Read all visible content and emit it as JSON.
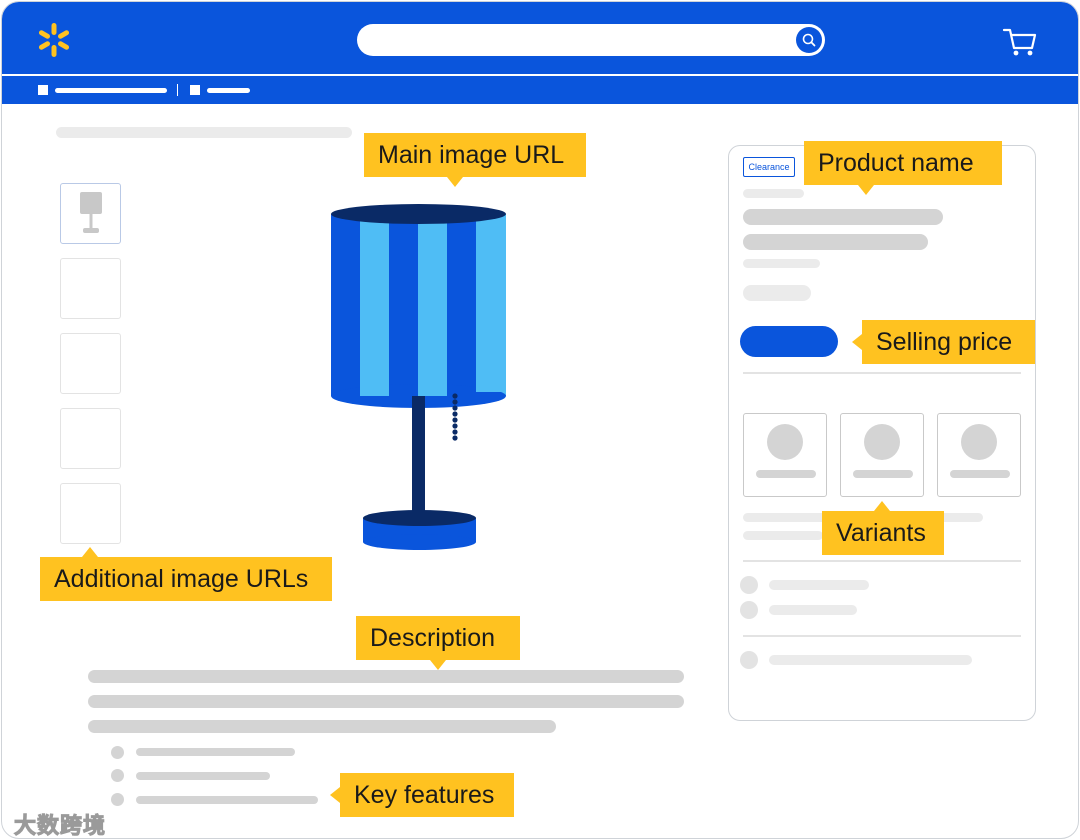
{
  "header": {
    "logo_icon": "spark-icon",
    "search": {
      "placeholder": "",
      "button_icon": "search-icon"
    },
    "cart_icon": "cart-icon",
    "brand_color": "#0a55dc",
    "logo_color": "#ffc220"
  },
  "product_panel": {
    "badge": "Clearance"
  },
  "callouts": {
    "main_image": "Main image URL",
    "product_name": "Product name",
    "selling_price": "Selling price",
    "variants": "Variants",
    "additional_images": "Additional image URLs",
    "description": "Description",
    "key_features": "Key features"
  },
  "lamp_colors": {
    "dark_blue": "#0a55dc",
    "light_blue": "#4fbdf5",
    "navy": "#0a2a66"
  },
  "watermark": "大数跨境"
}
